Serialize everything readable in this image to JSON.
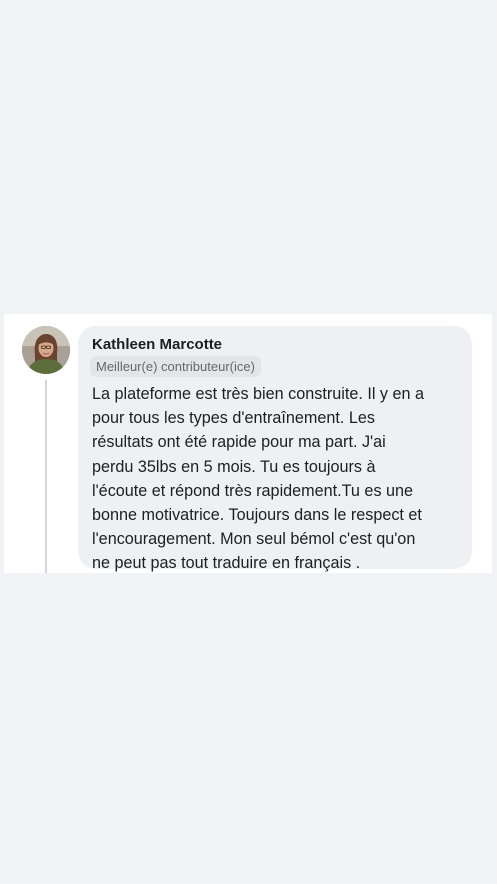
{
  "comment": {
    "author": "Kathleen Marcotte",
    "badge": "Meilleur(e) contributeur(ice)",
    "text": "La plateforme est très bien construite. Il y en a\npour tous les types d'entraînement. Les\nrésultats ont été rapide pour ma part. J'ai\nperdu 35lbs en 5 mois. Tu es toujours à\nl'écoute et répond très rapidement.Tu es une\nbonne motivatrice. Toujours dans le respect et\nl'encouragement. Mon seul bémol c'est qu'on\nne peut pas tout traduire en français ."
  },
  "colors": {
    "page_background": "#f1f3f6",
    "card_background": "#ffffff",
    "bubble_background": "#eef0f3",
    "badge_background": "#e3e5e9",
    "text": "#1c1e21",
    "secondary_text": "#65676b"
  }
}
